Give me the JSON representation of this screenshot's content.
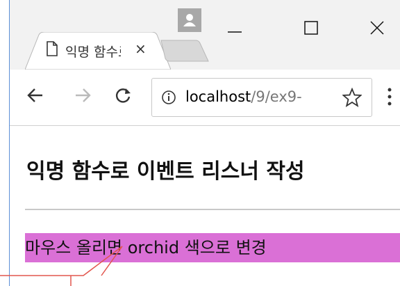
{
  "browser": {
    "tab_title": "익명 함수로 이벤트 리스너 작성",
    "tab_close_glyph": "×",
    "url_host": "localhost",
    "url_path": "/9/ex9-"
  },
  "page": {
    "heading": "익명 함수로 이벤트 리스너 작성",
    "hover_text": "마우스 올리면 orchid 색으로 변경"
  },
  "colors": {
    "hover_background": "#da70d6",
    "window_border": "#5b8fd6"
  },
  "icons": [
    "profile-icon",
    "minimize-icon",
    "maximize-icon",
    "close-icon",
    "document-icon",
    "back-icon",
    "forward-icon",
    "reload-icon",
    "info-icon",
    "star-icon",
    "menu-icon"
  ]
}
